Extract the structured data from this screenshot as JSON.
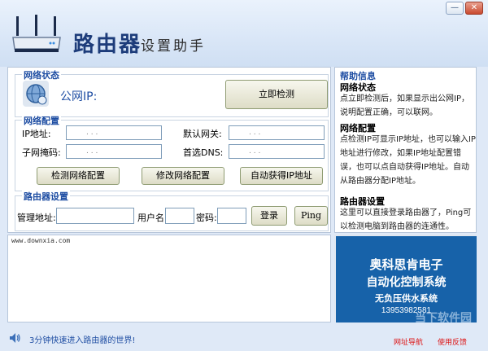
{
  "window": {
    "title_main": "路由器",
    "title_sub": "设置助手",
    "minimize_icon": "minimize-icon",
    "close_icon": "close-icon"
  },
  "status": {
    "group_title": "网络状态",
    "public_ip_label": "公网IP:",
    "detect_button": "立即检测"
  },
  "config": {
    "group_title": "网络配置",
    "ip_label": "IP地址:",
    "gateway_label": "默认网关:",
    "mask_label": "子网掩码:",
    "dns_label": "首选DNS:",
    "ip_dots": ".        .        .",
    "gateway_dots": ".        .        .",
    "mask_dots": ".        .        .",
    "dns_dots": ".        .        .",
    "btn_detect": "检测网络配置",
    "btn_modify": "修改网络配置",
    "btn_auto": "自动获得IP地址"
  },
  "router": {
    "group_title": "路由器设置",
    "address_label": "管理地址:",
    "user_label": "用户名:",
    "password_label": "密码:",
    "login_button": "登录",
    "ping_button": "Ping",
    "address_value": "",
    "user_value": "",
    "password_value": ""
  },
  "help": {
    "title": "帮助信息",
    "s1_title": "网络状态",
    "s1_text": "点立即检测后，如果显示出公网IP，说明配置正确，可以联网。",
    "s2_title": "网络配置",
    "s2_text": "点检测IP可显示IP地址，也可以输入IP地址进行修改，如果IP地址配置错误，也可以点自动获得IP地址。自动从路由器分配IP地址。",
    "s3_title": "路由器设置",
    "s3_text": "这里可以直接登录路由器了，Ping可以检测电脑到路由器的连通性。"
  },
  "log": {
    "text": "www.downxia.com"
  },
  "ad": {
    "line1": "奥科思肯电子",
    "line2": "自动化控制系统",
    "line3": "无负压供水系统",
    "phone": "13953982581"
  },
  "watermark": "当下软件园",
  "statusbar": {
    "text": "3分钟快速进入路由器的世界!",
    "link1": "网址导航",
    "link2": "使用反馈"
  }
}
